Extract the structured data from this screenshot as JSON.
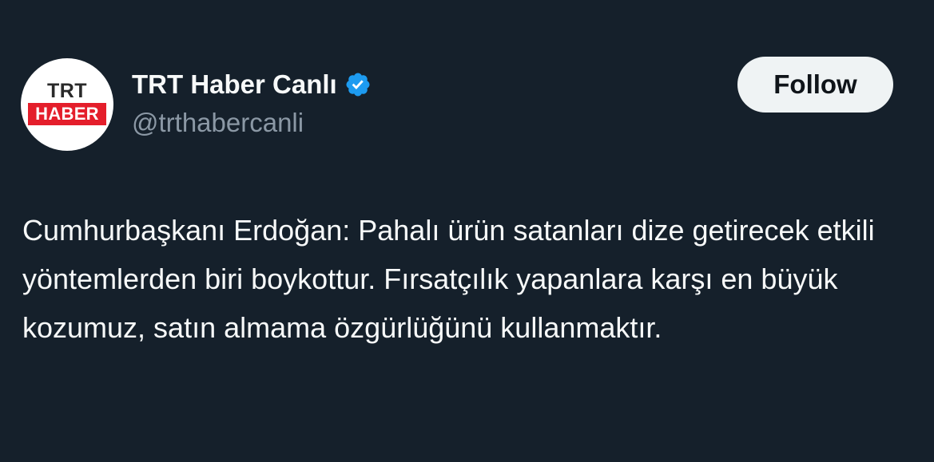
{
  "tweet": {
    "author": {
      "display_name": "TRT Haber Canlı",
      "handle": "@trthabercanli",
      "verified": true,
      "avatar": {
        "logo_line_1": "TRT",
        "logo_line_2": "HABER"
      }
    },
    "follow_label": "Follow",
    "text": "Cumhurbaşkanı Erdoğan: Pahalı ürün satanları dize getirecek etkili yöntemlerden biri boykottur. Fırsatçılık yapanlara karşı en büyük kozumuz, satın almama özgürlüğünü kullanmaktır."
  },
  "colors": {
    "background": "#15202b",
    "primary_text": "#f7f9f9",
    "secondary_text": "#8b98a5",
    "verified_badge": "#1d9bf0",
    "follow_button_bg": "#eff3f4",
    "brand_red": "#e41e2b"
  },
  "icons": {
    "verified": "verified-badge-icon"
  }
}
